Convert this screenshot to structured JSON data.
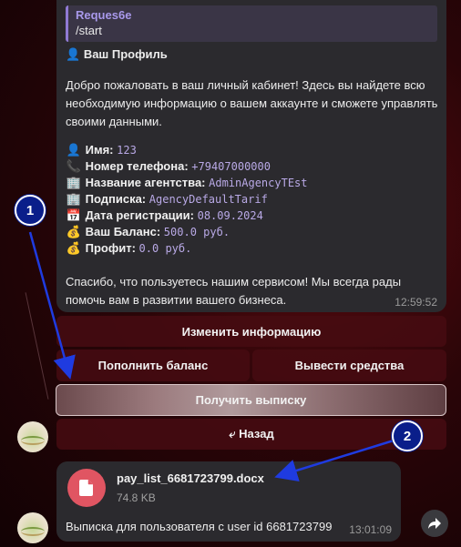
{
  "message": {
    "reply": {
      "author": "Reques6e",
      "text": "/start"
    },
    "title": "Ваш Профиль",
    "welcome": "Добро пожаловать в ваш личный кабинет! Здесь вы найдете всю необходимую информацию о вашем аккаунте и сможете управлять своими данными.",
    "fields": [
      {
        "icon": "👤",
        "label": "Имя:",
        "value": "123"
      },
      {
        "icon": "📞",
        "label": "Номер телефона:",
        "value": "+79407000000"
      },
      {
        "icon": "🏢",
        "label": "Название агентства:",
        "value": "AdminAgencyTEst"
      },
      {
        "icon": "🏢",
        "label": "Подписка:",
        "value": "AgencyDefaultTarif"
      },
      {
        "icon": "📅",
        "label": "Дата регистрации:",
        "value": "08.09.2024"
      },
      {
        "icon": "💰",
        "label": "Ваш Баланс:",
        "value": "500.0 руб."
      },
      {
        "icon": "💰",
        "label": "Профит:",
        "value": "0.0 руб."
      }
    ],
    "thanks": "Спасибо, что пользуетесь нашим сервисом! Мы всегда рады помочь вам в развитии вашего бизнеса.",
    "time": "12:59:52"
  },
  "keyboard": {
    "edit": "Изменить информацию",
    "topup": "Пополнить баланс",
    "withdraw": "Вывести средства",
    "statement": "Получить выписку",
    "back": "⤶ Назад"
  },
  "file_message": {
    "file_name": "pay_list_6681723799.docx",
    "file_size": "74.8 KB",
    "caption": "Выписка для пользователя с user id 6681723799",
    "time": "13:01:09"
  },
  "annotations": {
    "marker1": "1",
    "marker2": "2"
  },
  "colors": {
    "accent": "#8f7ad3",
    "file_icon": "#e05562",
    "marker": "#0a1e8a",
    "arrow": "#1f3be0"
  }
}
